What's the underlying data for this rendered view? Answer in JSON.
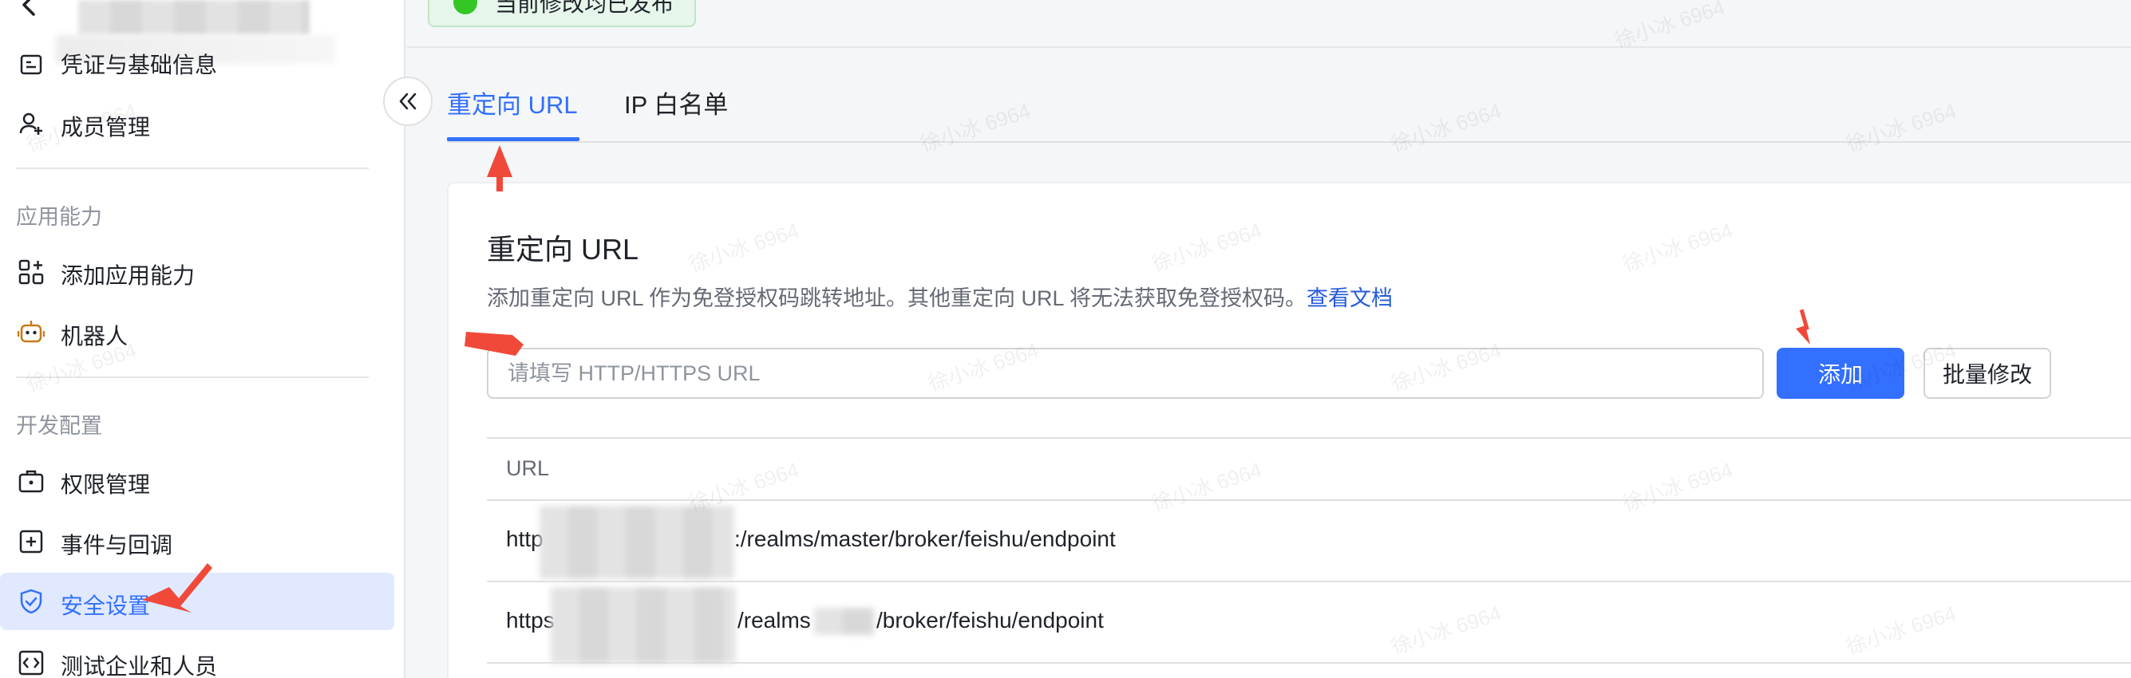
{
  "toast": {
    "text": "当前修改均已发布"
  },
  "sidebar": {
    "items": [
      {
        "label": "凭证与基础信息",
        "icon": "credential-icon"
      },
      {
        "label": "成员管理",
        "icon": "user-add-icon"
      },
      {
        "label": "添加应用能力",
        "icon": "apps-add-icon"
      },
      {
        "label": "机器人",
        "icon": "robot-icon"
      },
      {
        "label": "权限管理",
        "icon": "briefcase-icon"
      },
      {
        "label": "事件与回调",
        "icon": "event-plus-icon"
      },
      {
        "label": "安全设置",
        "icon": "shield-icon"
      },
      {
        "label": "测试企业和人员",
        "icon": "code-box-icon"
      }
    ],
    "sections": {
      "app_capability": "应用能力",
      "dev_config": "开发配置"
    }
  },
  "tabs": [
    {
      "label": "重定向 URL",
      "active": true
    },
    {
      "label": "IP 白名单",
      "active": false
    }
  ],
  "card": {
    "title": "重定向 URL",
    "description": "添加重定向 URL 作为免登授权码跳转地址。其他重定向 URL 将无法获取免登授权码。",
    "doc_link": "查看文档",
    "input_placeholder": "请填写 HTTP/HTTPS URL",
    "add_button": "添加",
    "batch_button": "批量修改",
    "table": {
      "header": "URL",
      "rows": [
        {
          "prefix": "http",
          "suffix": ":/realms/master/broker/feishu/endpoint"
        },
        {
          "prefix": "https",
          "middle": "/realms",
          "suffix": "/broker/feishu/endpoint"
        }
      ]
    }
  },
  "watermark": "徐小冰 6964",
  "colors": {
    "primary": "#3370ff",
    "active_bg": "#e0e9ff",
    "annotation": "#f0493a",
    "success": "#34c724"
  }
}
